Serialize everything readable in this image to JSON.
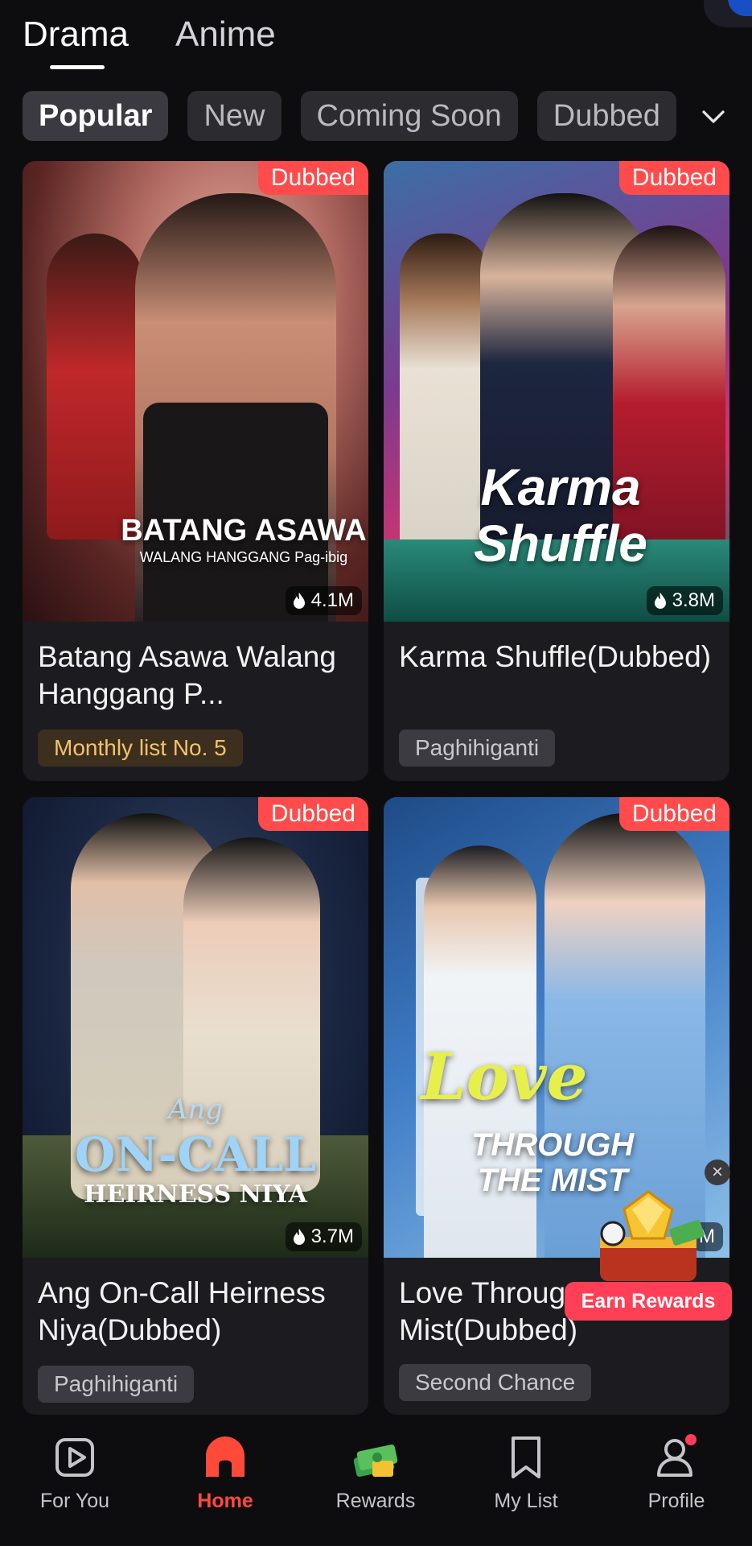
{
  "top_tabs": [
    {
      "label": "Drama",
      "active": true
    },
    {
      "label": "Anime",
      "active": false
    }
  ],
  "filters": [
    {
      "label": "Popular",
      "active": true
    },
    {
      "label": "New",
      "active": false
    },
    {
      "label": "Coming Soon",
      "active": false
    },
    {
      "label": "Dubbed",
      "active": false
    }
  ],
  "cards": [
    {
      "badge": "Dubbed",
      "views": "4.1M",
      "poster_title": "BATANG ASAWA",
      "poster_subtitle": "WALANG HANGGANG Pag-ibig",
      "title": "Batang Asawa Walang Hanggang P...",
      "tag": "Monthly list No. 5"
    },
    {
      "badge": "Dubbed",
      "views": "3.8M",
      "poster_title": "Karma Shuffle",
      "title": "Karma Shuffle(Dubbed)",
      "tag": "Paghihiganti"
    },
    {
      "badge": "Dubbed",
      "views": "3.7M",
      "poster_title": "ON-CALL",
      "poster_pre": "Ang",
      "poster_subtitle": "HEIRNESS NIYA",
      "title": "Ang On-Call Heirness Niya(Dubbed)",
      "tag": "Paghihiganti"
    },
    {
      "badge": "Dubbed",
      "views": "M",
      "poster_title": "Love",
      "poster_subtitle": "THROUGH THE MIST",
      "title": "Love Throug Mist(Dubbed)",
      "tag": "Second Chance"
    }
  ],
  "rewards": {
    "button": "Earn Rewards",
    "close": "×"
  },
  "nav": [
    {
      "label": "For You",
      "icon": "play-icon",
      "active": false
    },
    {
      "label": "Home",
      "icon": "home-icon",
      "active": true
    },
    {
      "label": "Rewards",
      "icon": "money-stack-icon",
      "active": false
    },
    {
      "label": "My List",
      "icon": "bookmark-icon",
      "active": false
    },
    {
      "label": "Profile",
      "icon": "user-icon",
      "active": false
    }
  ],
  "colors": {
    "accent": "#ff4a3a",
    "badge": "#ff4b4b",
    "background": "#0d0d10",
    "card": "#1c1c20"
  }
}
